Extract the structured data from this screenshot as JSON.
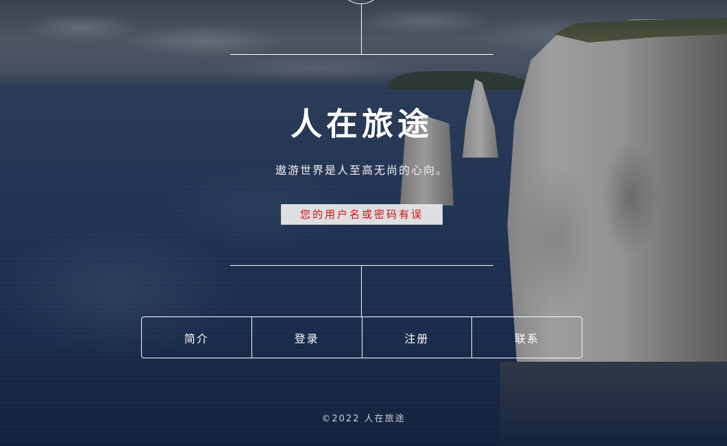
{
  "site": {
    "title": "人在旅途",
    "tagline": "遨游世界是人至高无尚的心向。"
  },
  "error": {
    "message": "您的用户名或密码有误"
  },
  "nav": {
    "items": [
      {
        "label": "简介"
      },
      {
        "label": "登录"
      },
      {
        "label": "注册"
      },
      {
        "label": "联系"
      }
    ]
  },
  "footer": {
    "copyright": "©2022 人在旅途"
  },
  "colors": {
    "text": "#ffffff",
    "error_text": "#d10f0f",
    "error_bg": "#e8e8e8",
    "sea": "#22375a"
  }
}
